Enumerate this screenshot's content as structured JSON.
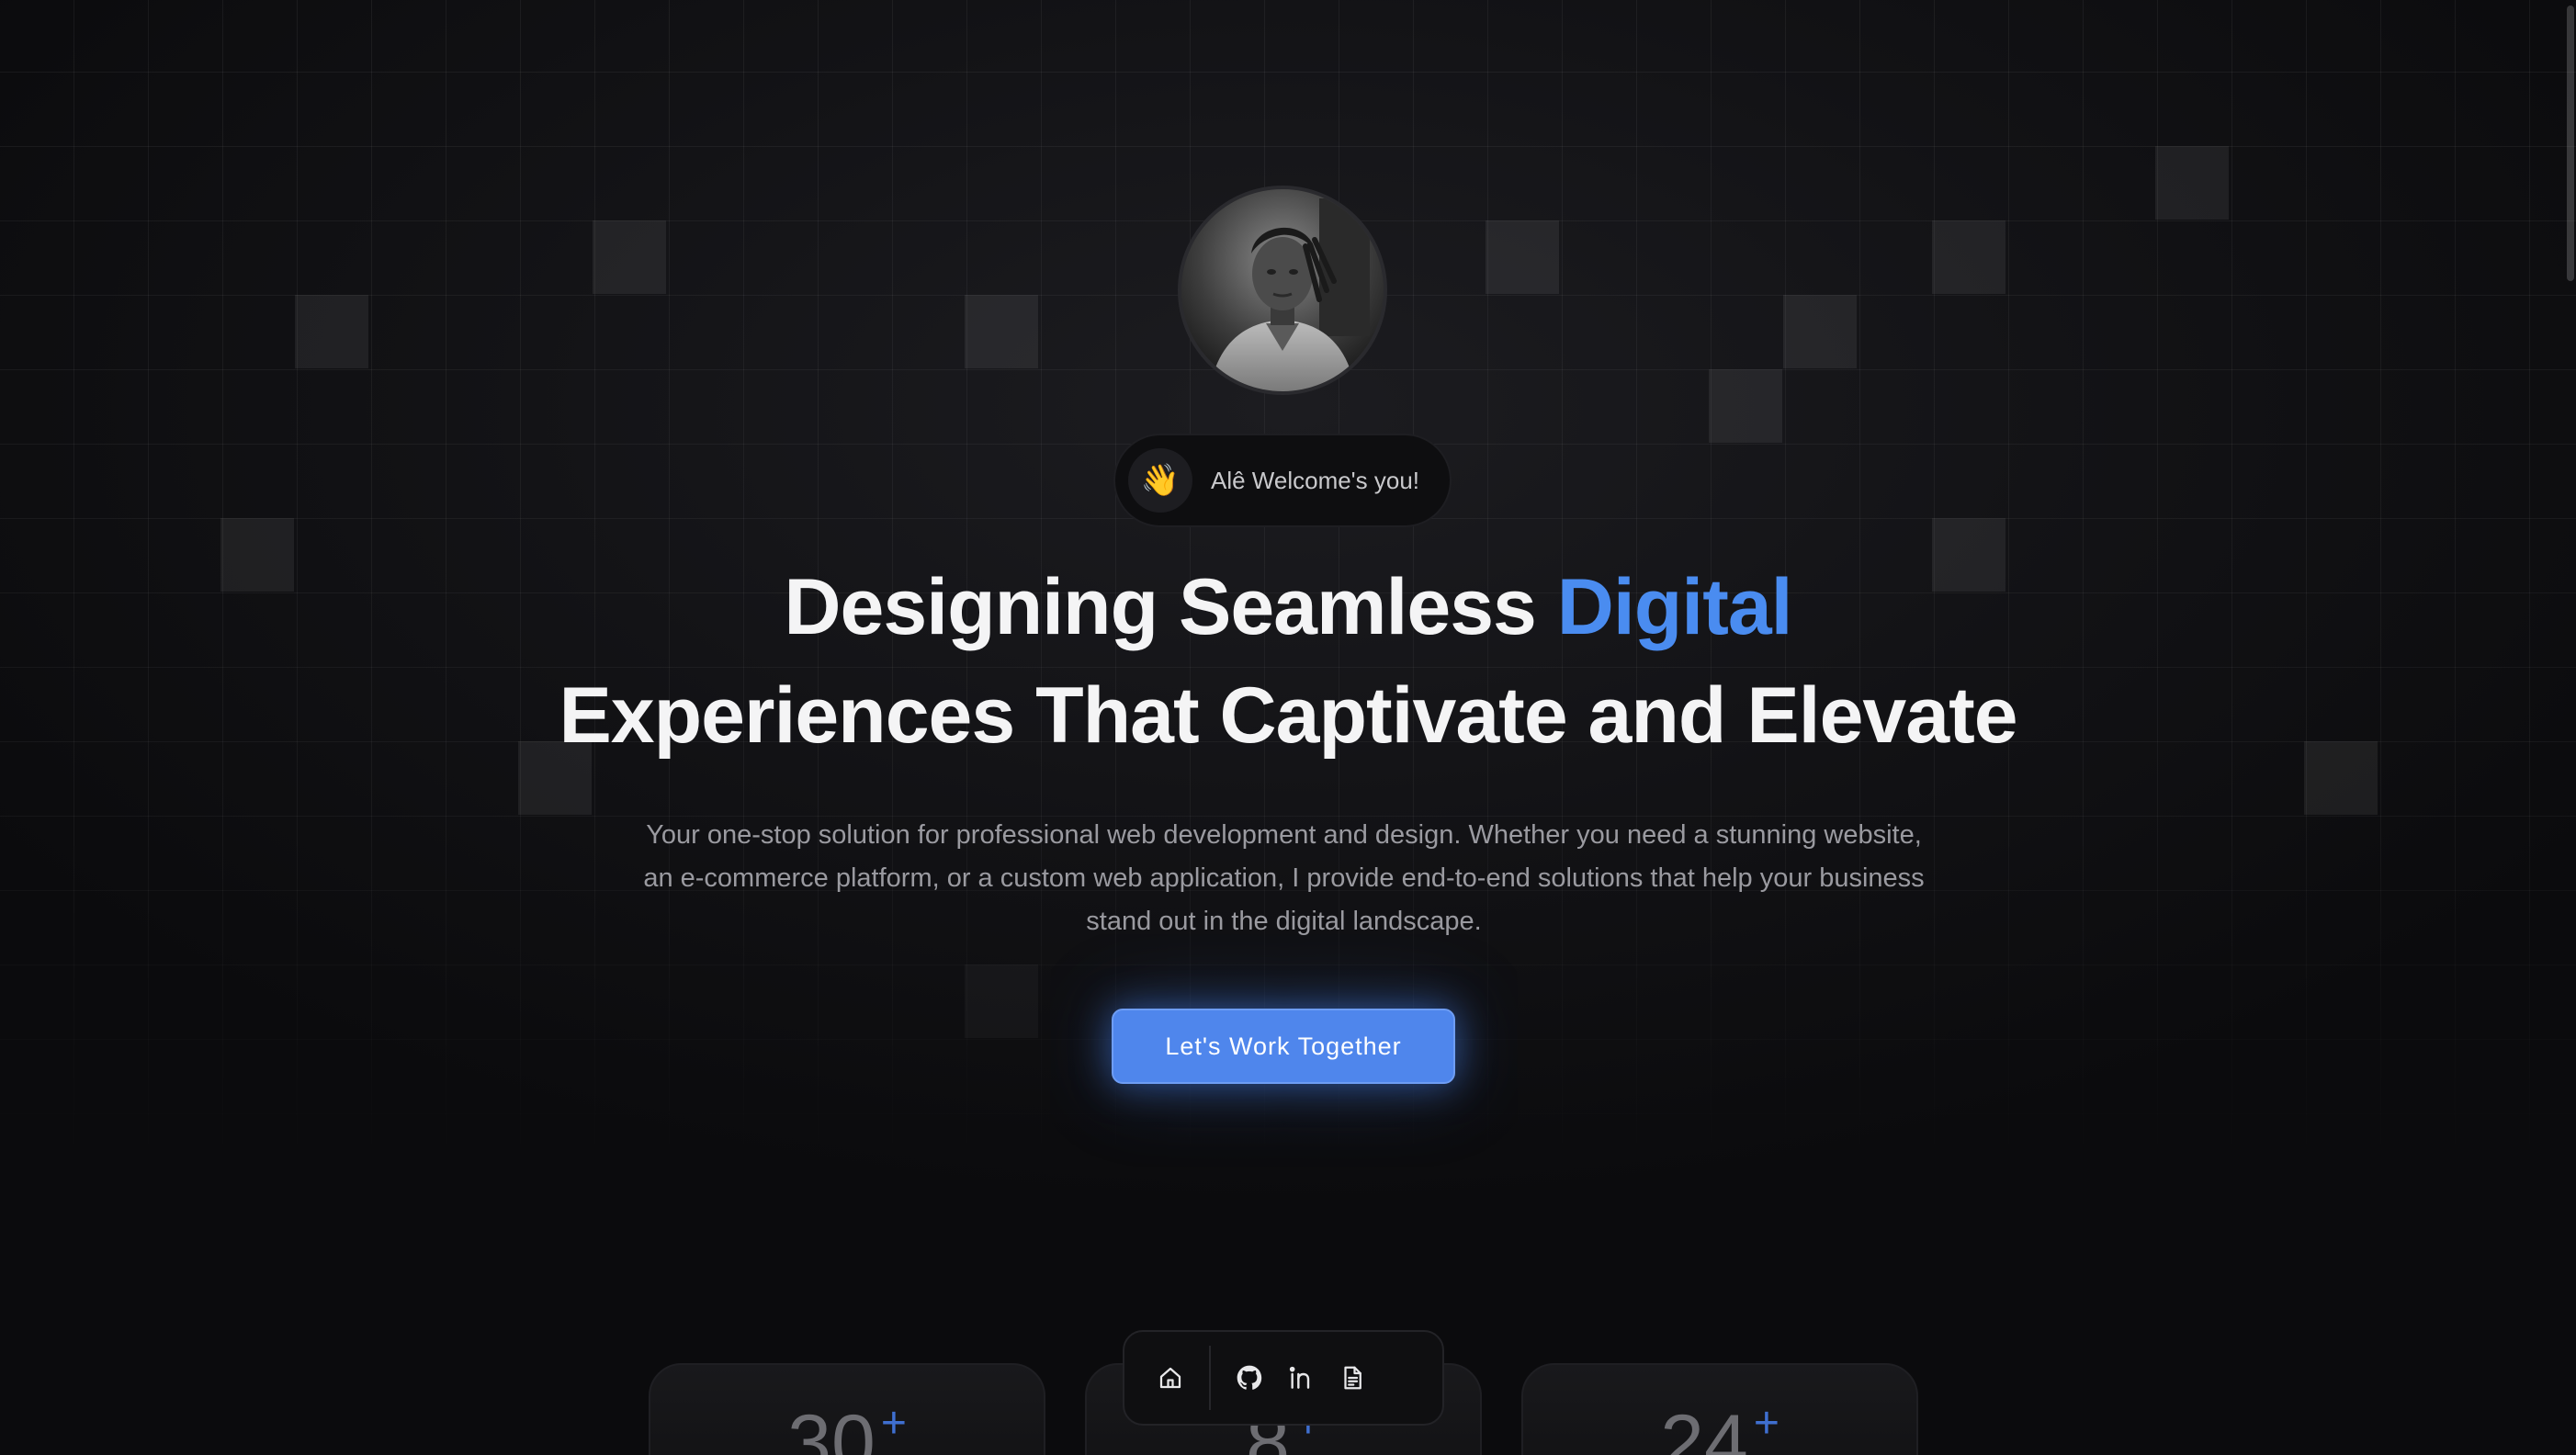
{
  "welcome": {
    "emoji": "👋",
    "text": "Alê Welcome's you!"
  },
  "headline": {
    "line1_prefix": "Designing Seamless ",
    "line1_accent": "Digital",
    "line2": "Experiences That Captivate and Elevate"
  },
  "subtitle": "Your one-stop solution for professional web development and design. Whether you need a stunning website, an e-commerce platform, or a custom web application, I provide end-to-end solutions that help your business stand out in the digital landscape.",
  "cta": {
    "label": "Let's Work Together"
  },
  "stats": [
    {
      "number": "30",
      "suffix": "+"
    },
    {
      "number": "8",
      "suffix": "+"
    },
    {
      "number": "24",
      "suffix": "+"
    }
  ],
  "dock": {
    "icons": [
      "home-icon",
      "github-icon",
      "linkedin-icon",
      "document-icon"
    ]
  },
  "colors": {
    "accent": "#4a8cf0",
    "button": "#4f86ec",
    "background": "#0b0b0d"
  }
}
